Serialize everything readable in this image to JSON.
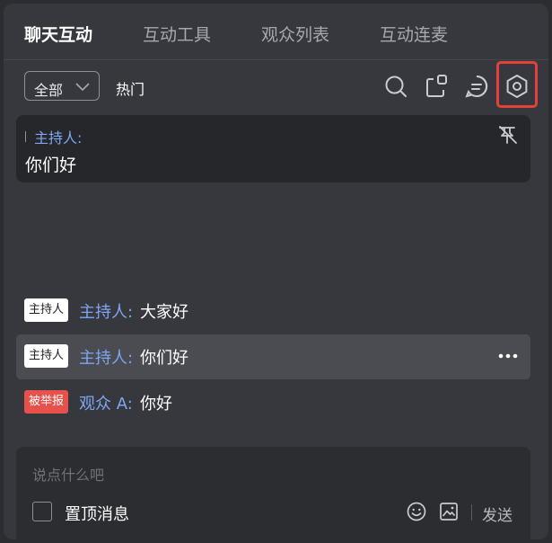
{
  "tabs": [
    {
      "label": "聊天互动",
      "active": true
    },
    {
      "label": "互动工具",
      "active": false
    },
    {
      "label": "观众列表",
      "active": false
    },
    {
      "label": "互动连麦",
      "active": false
    }
  ],
  "filter": {
    "selected": "全部",
    "hot_label": "热门"
  },
  "toolbar": {
    "icons": [
      "search-icon",
      "popout-icon",
      "message-icon",
      "settings-icon"
    ],
    "highlight_color": "#e5413b"
  },
  "pinned": {
    "author": "主持人:",
    "text": "你们好"
  },
  "messages": [
    {
      "badge": "主持人",
      "badge_type": "host",
      "name": "主持人:",
      "text": "大家好"
    },
    {
      "badge": "主持人",
      "badge_type": "host",
      "name": "主持人:",
      "text": "你们好"
    },
    {
      "badge": "被举报",
      "badge_type": "reported",
      "name": "观众 A:",
      "text": "你好"
    }
  ],
  "input": {
    "placeholder": "说点什么吧",
    "pin_label": "置顶消息",
    "send_label": "发送"
  },
  "colors": {
    "accent_name": "#7ea6f2",
    "reported_badge": "#e6514b",
    "background": "#36383d"
  }
}
